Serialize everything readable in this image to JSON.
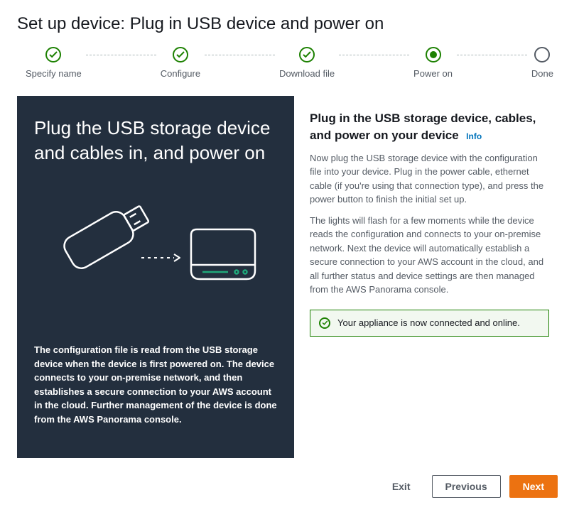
{
  "page_title": "Set up device: Plug in USB device and power on",
  "stepper": [
    {
      "label": "Specify name",
      "state": "done"
    },
    {
      "label": "Configure",
      "state": "done"
    },
    {
      "label": "Download file",
      "state": "done"
    },
    {
      "label": "Power on",
      "state": "current"
    },
    {
      "label": "Done",
      "state": "future"
    }
  ],
  "left": {
    "title": "Plug the USB storage device and cables in, and power on",
    "description": "The configuration file is read from the USB storage device when the device is first powered on. The device connects to your on-premise network, and then establishes a secure connection to your AWS account in the cloud. Further management of the device is done from the AWS Panorama console."
  },
  "right": {
    "title": "Plug in the USB storage device, cables, and power on your device",
    "info_label": "Info",
    "para1": "Now plug the USB storage device with the configuration file into your device. Plug in the power cable, ethernet cable (if you're using that connection type), and press the power button to finish the initial set up.",
    "para2": "The lights will flash for a few moments while the device reads the configuration and connects to your on-premise network. Next the device will automatically establish a secure connection to your AWS account in the cloud, and all further status and device settings are then managed from the AWS Panorama console.",
    "status": "Your appliance is now connected and online."
  },
  "footer": {
    "exit": "Exit",
    "previous": "Previous",
    "next": "Next"
  }
}
